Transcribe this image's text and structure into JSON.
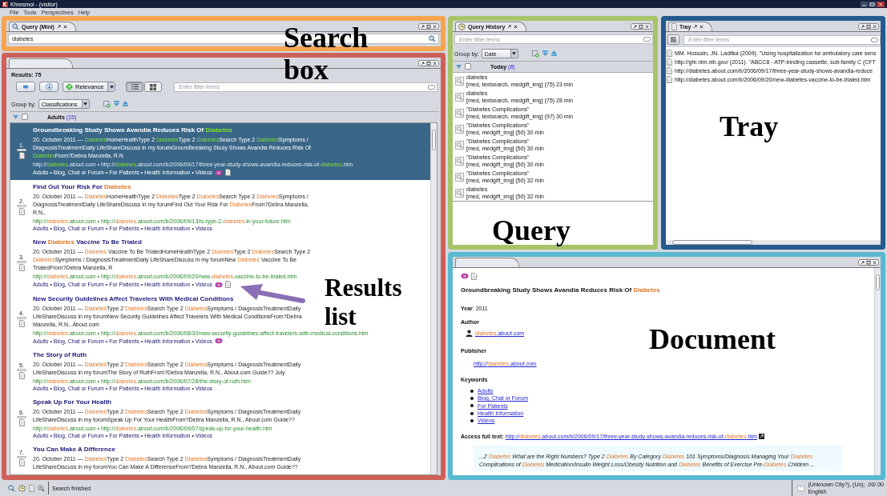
{
  "window": {
    "title": "Khresmoi - (visitor)"
  },
  "menu": [
    "File",
    "Tools",
    "Perspectives",
    "Help"
  ],
  "search_panel": {
    "tab": "Query (Mini)",
    "value": "diabetes",
    "annotation": "Search box"
  },
  "results_panel": {
    "annotation": "Results list",
    "annotation_arrow": true,
    "count_label": "Results: 75",
    "sort": "Relevance",
    "views": [
      {
        "kind": "list",
        "selected": true
      },
      {
        "kind": "grid",
        "selected": false
      }
    ],
    "filter_placeholder": "Enter filter terms",
    "group_by_label": "Group by:",
    "group_by": "Classifications",
    "group": {
      "name": "Adults",
      "count": "(15)",
      "expanded": true,
      "checked": false
    },
    "results": [
      {
        "number": "1.",
        "selected": true,
        "preview": true,
        "attachment": true,
        "title": [
          {
            "text": "Groundbreaking Study Shows Avandia Reduces Risk Of ",
            "highlighted": false
          },
          {
            "text": "Diabetes",
            "highlighted": true
          }
        ],
        "snippet": [
          {
            "text": "20. October 2011 — ",
            "highlighted": false
          },
          {
            "text": "Diabetes",
            "highlighted": true
          },
          {
            "text": "HomeHealthType 2 ",
            "highlighted": false
          },
          {
            "text": "Diabetes",
            "highlighted": true
          },
          {
            "text": "Type 2 ",
            "highlighted": false
          },
          {
            "text": "Diabetes",
            "highlighted": true
          },
          {
            "text": "Search Type 2 ",
            "highlighted": false
          },
          {
            "text": "Diabetes",
            "highlighted": true
          },
          {
            "text": "Symptoms / DiagnosisTreatmentDaily LifeShareDiscuss in my forumGroundbreaking Study Shows Avandia Reduces Risk Of ",
            "highlighted": false
          },
          {
            "text": "Diabetes",
            "highlighted": true
          },
          {
            "text": "From?Debra Manzella, R.N",
            "highlighted": false
          }
        ],
        "url": [
          {
            "text": "http://",
            "highlighted": false
          },
          {
            "text": "diabetes",
            "highlighted": true
          },
          {
            "text": ".about.com • http://",
            "highlighted": false
          },
          {
            "text": "diabetes",
            "highlighted": true
          },
          {
            "text": ".about.com/b/2006/09/17/three-year-study-shows-avandia-reduces-risk-of-",
            "highlighted": false
          },
          {
            "text": "diabetes",
            "highlighted": true
          },
          {
            "text": ".htm",
            "highlighted": false
          }
        ],
        "tags": "Adults • Blog, Chat or Forum • For Patients • Health Information • Videos"
      },
      {
        "number": "2.",
        "selected": false,
        "preview": false,
        "attachment": false,
        "title": [
          {
            "text": "Find Out Your Risk For ",
            "highlighted": false
          },
          {
            "text": "Diabetes",
            "highlighted": true
          }
        ],
        "snippet": [
          {
            "text": "20. October 2011 — ",
            "highlighted": false
          },
          {
            "text": "Diabetes",
            "highlighted": true
          },
          {
            "text": "HomeHealthType 2 ",
            "highlighted": false
          },
          {
            "text": "Diabetes",
            "highlighted": true
          },
          {
            "text": "Type 2 ",
            "highlighted": false
          },
          {
            "text": "Diabetes",
            "highlighted": true
          },
          {
            "text": "Search Type 2 ",
            "highlighted": false
          },
          {
            "text": "Diabetes",
            "highlighted": true
          },
          {
            "text": "Symptoms / DiagnosisTreatmentDaily LifeShareDiscuss in my forumFind Out Your Risk For ",
            "highlighted": false
          },
          {
            "text": "Diabetes",
            "highlighted": true
          },
          {
            "text": "From?Debra Manzella, R.N.,",
            "highlighted": false
          }
        ],
        "url": [
          {
            "text": "http://",
            "highlighted": false
          },
          {
            "text": "diabetes",
            "highlighted": true
          },
          {
            "text": ".about.com • http://",
            "highlighted": false
          },
          {
            "text": "diabetes",
            "highlighted": true
          },
          {
            "text": ".about.com/b/2006/09/13/is-type-2-",
            "highlighted": false
          },
          {
            "text": "diabetes",
            "highlighted": true
          },
          {
            "text": "-in-your-future.htm",
            "highlighted": false
          }
        ],
        "tags": "Adults • Blog, Chat or Forum • For Patients • Health Information • Videos"
      },
      {
        "number": "3.",
        "selected": false,
        "preview": true,
        "attachment": true,
        "title": [
          {
            "text": "New ",
            "highlighted": false
          },
          {
            "text": "Diabetes",
            "highlighted": true
          },
          {
            "text": " Vaccine To Be Trialed",
            "highlighted": false
          }
        ],
        "snippet": [
          {
            "text": "20. October 2011 — ",
            "highlighted": false
          },
          {
            "text": "Diabetes",
            "highlighted": true
          },
          {
            "text": " Vaccine To Be TrialedHomeHealthType 2 ",
            "highlighted": false
          },
          {
            "text": "Diabetes",
            "highlighted": true
          },
          {
            "text": "Type 2 ",
            "highlighted": false
          },
          {
            "text": "Diabetes",
            "highlighted": true
          },
          {
            "text": "Search Type 2 ",
            "highlighted": false
          },
          {
            "text": "Diabetes",
            "highlighted": true
          },
          {
            "text": "Symptoms / DiagnosisTreatmentDaily LifeShareDiscuss in my forumNew ",
            "highlighted": false
          },
          {
            "text": "Diabetes",
            "highlighted": true
          },
          {
            "text": " Vaccine To Be TrialedFrom?Debra Manzella, R",
            "highlighted": false
          }
        ],
        "url": [
          {
            "text": "http://",
            "highlighted": false
          },
          {
            "text": "diabetes",
            "highlighted": true
          },
          {
            "text": ".about.com • http://",
            "highlighted": false
          },
          {
            "text": "diabetes",
            "highlighted": true
          },
          {
            "text": ".about.com/b/2006/09/20/new-",
            "highlighted": false
          },
          {
            "text": "diabetes",
            "highlighted": true
          },
          {
            "text": "-vaccine-to-be-trialed.htm",
            "highlighted": false
          }
        ],
        "tags": "Adults • Blog, Chat or Forum • For Patients • Health Information • Videos"
      },
      {
        "number": "4.",
        "selected": false,
        "preview": true,
        "attachment": false,
        "title": [
          {
            "text": "New Security Guidelines Affect Travelers With Medical Conditions",
            "highlighted": false
          }
        ],
        "snippet": [
          {
            "text": "20. October 2011 — ",
            "highlighted": false
          },
          {
            "text": "Diabetes",
            "highlighted": true
          },
          {
            "text": "Type 2 ",
            "highlighted": false
          },
          {
            "text": "Diabetes",
            "highlighted": true
          },
          {
            "text": "Search Type 2 ",
            "highlighted": false
          },
          {
            "text": "Diabetes",
            "highlighted": true
          },
          {
            "text": "Symptoms / DiagnosisTreatmentDaily LifeShareDiscuss in my forumNew Security Guidelines Affect Travelers With Medical ConditionsFrom?Debra Manzella, R.N., About.com",
            "highlighted": false
          }
        ],
        "url": [
          {
            "text": "http://",
            "highlighted": false
          },
          {
            "text": "diabetes",
            "highlighted": true
          },
          {
            "text": ".about.com • http://",
            "highlighted": false
          },
          {
            "text": "diabetes",
            "highlighted": true
          },
          {
            "text": ".about.com/b/2006/08/30/new-security-guidelines-affect-travelers-with-medical-conditions.htm",
            "highlighted": false
          }
        ],
        "tags": "Adults • Blog, Chat or Forum • For Patients • Health Information • Videos"
      },
      {
        "number": "5.",
        "selected": false,
        "preview": false,
        "attachment": false,
        "title": [
          {
            "text": "The Story of Ruth",
            "highlighted": false
          }
        ],
        "snippet": [
          {
            "text": "20. October 2011 — ",
            "highlighted": false
          },
          {
            "text": "Diabetes",
            "highlighted": true
          },
          {
            "text": "Type 2 ",
            "highlighted": false
          },
          {
            "text": "Diabetes",
            "highlighted": true
          },
          {
            "text": "Search Type 2 ",
            "highlighted": false
          },
          {
            "text": "Diabetes",
            "highlighted": true
          },
          {
            "text": "Symptoms / DiagnosisTreatmentDaily LifeShareDiscuss in my forumThe Story of RuthFrom?Debra Manzella, R.N., About.com Guide?? July",
            "highlighted": false
          }
        ],
        "url": [
          {
            "text": "http://",
            "highlighted": false
          },
          {
            "text": "diabetes",
            "highlighted": true
          },
          {
            "text": ".about.com • http://",
            "highlighted": false
          },
          {
            "text": "diabetes",
            "highlighted": true
          },
          {
            "text": ".about.com/b/2006/07/28/the-story-of-ruth.htm",
            "highlighted": false
          }
        ],
        "tags": "Adults • Blog, Chat or Forum • For Patients • Health Information • Videos"
      },
      {
        "number": "6.",
        "selected": false,
        "preview": false,
        "attachment": false,
        "title": [
          {
            "text": "Speak Up For Your Health",
            "highlighted": false
          }
        ],
        "snippet": [
          {
            "text": "20. October 2011 — ",
            "highlighted": false
          },
          {
            "text": "Diabetes",
            "highlighted": true
          },
          {
            "text": "Type 2 ",
            "highlighted": false
          },
          {
            "text": "Diabetes",
            "highlighted": true
          },
          {
            "text": "Search Type 2 ",
            "highlighted": false
          },
          {
            "text": "Diabetes",
            "highlighted": true
          },
          {
            "text": "Symptoms / DiagnosisTreatmentDaily LifeShareDiscuss in my forumSpeak Up For Your HealthFrom?Debra Manzella, R.N., About.com Guide??",
            "highlighted": false
          }
        ],
        "url": [
          {
            "text": "http://",
            "highlighted": false
          },
          {
            "text": "diabetes",
            "highlighted": true
          },
          {
            "text": ".about.com • http://",
            "highlighted": false
          },
          {
            "text": "diabetes",
            "highlighted": true
          },
          {
            "text": ".about.com/b/2006/09/07/speak-up-for-your-health.htm",
            "highlighted": false
          }
        ],
        "tags": "Adults • Blog, Chat or Forum • For Patients • Health Information • Videos"
      },
      {
        "number": "7.",
        "selected": false,
        "preview": false,
        "attachment": false,
        "title": [
          {
            "text": "You Can Make A Difference",
            "highlighted": false
          }
        ],
        "snippet": [
          {
            "text": "20. October 2011 — ",
            "highlighted": false
          },
          {
            "text": "Diabetes",
            "highlighted": true
          },
          {
            "text": "Type 2 ",
            "highlighted": false
          },
          {
            "text": "Diabetes",
            "highlighted": true
          },
          {
            "text": "Search Type 2 ",
            "highlighted": false
          },
          {
            "text": "Diabetes",
            "highlighted": true
          },
          {
            "text": "Symptoms / DiagnosisTreatmentDaily LifeShareDiscuss in my forumYou Can Make A DifferenceFrom?Debra Manzella, R.N., About.com Guide??",
            "highlighted": false
          }
        ]
      }
    ]
  },
  "history_panel": {
    "tab": "Query History",
    "annotation": "Query",
    "filter_placeholder": "Enter filter terms",
    "group_by_label": "Group by:",
    "group_by": "Date",
    "group": {
      "name": "Today",
      "count": "(8)",
      "expanded": true,
      "checked": false
    },
    "items": [
      {
        "query": "diabetes",
        "details": "[med, textsearch, medgift_img] (75) 23 min"
      },
      {
        "query": "diabetes",
        "details": "[med, textsearch, medgift_img] (75) 28 min"
      },
      {
        "query": "\"Diabetes Complications\"",
        "details": "[med, textsearch, medgift_img] (97) 30 min"
      },
      {
        "query": "\"Diabetes Complications\"",
        "details": "[med, medgift_img] (50) 30 min"
      },
      {
        "query": "\"Diabetes Complications\"",
        "details": "[med, medgift_img] (50) 30 min"
      },
      {
        "query": "\"Diabetes Complications\"",
        "details": "[med, medgift_img] (50) 30 min"
      },
      {
        "query": "\"Diabetes Complications\"",
        "details": "[med, medgift_img] (50) 32 min"
      },
      {
        "query": "diabetes",
        "details": "[med, medgift_img] (50) 32 min"
      }
    ]
  },
  "tray_panel": {
    "tab": "Tray",
    "annotation": "Tray",
    "filter_placeholder": "Enter filter terms",
    "items": [
      "MM. Hossain, JN. Laditka (2009). \"Using hospitalization for ambulatory care sens",
      "http://ghr.nlm.nih.gov/ (2011). \"ABCC8 - ATP-binding cassette, sub-family C (CFT",
      "http://diabetes.about.com/b/2006/09/17/three-year-study-shows-avandia-reduce",
      "http://diabetes.about.com/b/2006/09/20/new-diabetes-vaccine-to-be-trialed.htm"
    ]
  },
  "document_panel": {
    "annotation": "Document",
    "preview": true,
    "attachment": true,
    "title": [
      {
        "text": "Groundbreaking Study Shows Avandia Reduces Risk Of ",
        "highlighted": false
      },
      {
        "text": "Diabetes",
        "highlighted": true
      }
    ],
    "year": "**Year**: 2011",
    "author_label": "Author",
    "author": [
      {
        "text": "diabetes",
        "highlighted": true
      },
      {
        "text": ".about.com",
        "highlighted": false
      }
    ],
    "publisher_label": "Publisher",
    "publisher": [
      {
        "text": "http://",
        "highlighted": false
      },
      {
        "text": "diabetes",
        "highlighted": true
      },
      {
        "text": ".about.com",
        "highlighted": false
      }
    ],
    "keywords_label": "Keywords",
    "keywords": [
      "Adults",
      "Blog, Chat or Forum",
      "For Patients",
      "Health Information",
      "Videos"
    ],
    "full_text_label": "Access full text:",
    "full_text_url": [
      {
        "text": "http://",
        "highlighted": false
      },
      {
        "text": "diabetes",
        "highlighted": true
      },
      {
        "text": ".about.com/b/2006/09/17/three-year-study-shows-avandia-reduces-risk-of-",
        "highlighted": false
      },
      {
        "text": "diabetes",
        "highlighted": true
      },
      {
        "text": ".htm",
        "highlighted": false
      }
    ],
    "excerpt": [
      {
        "text": "...2 ",
        "highlighted": false
      },
      {
        "text": "Diabetes",
        "highlighted": true
      },
      {
        "text": " What are the Right Numbers? Type 2 ",
        "highlighted": false
      },
      {
        "text": "Diabetes",
        "highlighted": true
      },
      {
        "text": " By Category ",
        "highlighted": false
      },
      {
        "text": "Diabetes",
        "highlighted": true
      },
      {
        "text": " 101 Symptoms/Diagnosis Managing Your ",
        "highlighted": false
      },
      {
        "text": "Diabetes",
        "highlighted": true
      },
      {
        "text": " Complications of ",
        "highlighted": false
      },
      {
        "text": "Diabetes",
        "highlighted": true
      },
      {
        "text": " Medication/Insulin Weight Loss/Obesity Nutrition and ",
        "highlighted": false
      },
      {
        "text": "Diabetes",
        "highlighted": true
      },
      {
        "text": " Benefits of Exercise Pre-",
        "highlighted": false
      },
      {
        "text": "Diabetes",
        "highlighted": true
      },
      {
        "text": " Children ...",
        "highlighted": false
      }
    ]
  },
  "status_bar": {
    "message": "Search finished",
    "location": "(Unknown City?), (Un); .00/.00",
    "language": "English"
  }
}
